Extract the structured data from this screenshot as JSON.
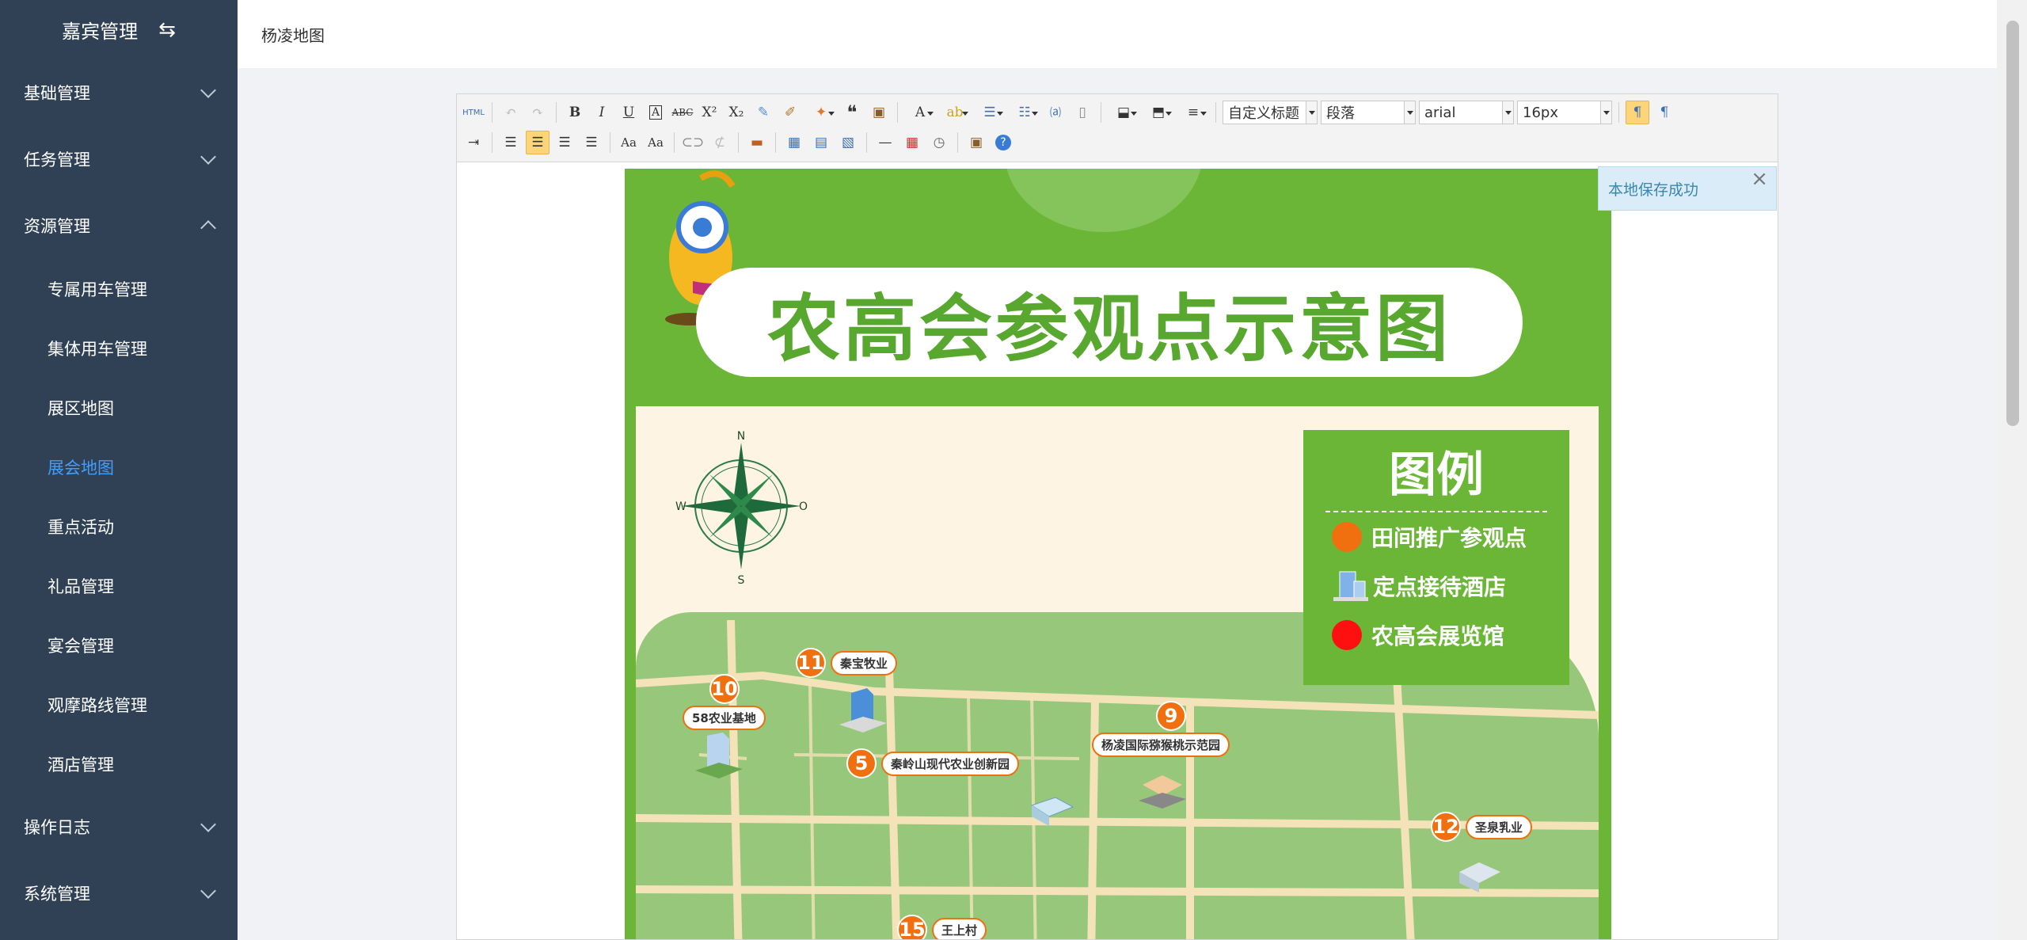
{
  "sidebar": {
    "brand": "嘉宾管理",
    "swap_icon": "⇆",
    "groups": [
      {
        "label": "基础管理",
        "expanded": false
      },
      {
        "label": "任务管理",
        "expanded": false
      },
      {
        "label": "资源管理",
        "expanded": true,
        "items": [
          "专属用车管理",
          "集体用车管理",
          "展区地图",
          "展会地图",
          "重点活动",
          "礼品管理",
          "宴会管理",
          "观摩路线管理",
          "酒店管理"
        ]
      },
      {
        "label": "操作日志",
        "expanded": false
      },
      {
        "label": "系统管理",
        "expanded": false
      }
    ],
    "active_item": "展会地图",
    "active_color": "#409eff",
    "background": "#304156"
  },
  "header": {
    "breadcrumb": "杨凌地图"
  },
  "editor": {
    "toolbar": {
      "row1_buttons": [
        "html-source",
        "undo",
        "redo",
        "bold",
        "italic",
        "underline",
        "font-border",
        "strikethrough",
        "superscript",
        "subscript",
        "remove-format",
        "format-match",
        "auto-typeset",
        "blockquote",
        "paste-plain",
        "font-color",
        "back-color",
        "insert-ordered-list",
        "insert-unordered-list",
        "select-all",
        "clear-doc",
        "row-spacing-top",
        "row-spacing-bottom",
        "line-height"
      ],
      "custom_style": "自定义标题",
      "paragraph": "段落",
      "font_family": "arial",
      "font_size": "16px",
      "row2_buttons": [
        "indent",
        "justify-left",
        "justify-center",
        "justify-right",
        "justify-justify",
        "to-uppercase",
        "to-lowercase",
        "link",
        "unlink",
        "insert-image",
        "insert-table",
        "merge-cells",
        "delete-table",
        "horizontal-rule",
        "date",
        "time",
        "paste-word",
        "help"
      ]
    },
    "html_label": "HTML",
    "toast": {
      "message": "本地保存成功",
      "close": "×"
    }
  },
  "poster": {
    "title": "农高会参观点示意图",
    "compass": {
      "n": "N",
      "s": "S",
      "w": "W",
      "e": "O"
    },
    "legend": {
      "title": "图例",
      "items": [
        {
          "icon": "orange-dot",
          "label": "田间推广参观点"
        },
        {
          "icon": "hotel-icon",
          "label": "定点接待酒店"
        },
        {
          "icon": "red-dot",
          "label": "农高会展览馆"
        }
      ]
    },
    "sites": [
      {
        "num": "11",
        "label": "秦宝牧业"
      },
      {
        "num": "10",
        "label": "58农业基地"
      },
      {
        "num": "9",
        "label": "杨凌国际猕猴桃示范园"
      },
      {
        "num": "5",
        "label": "秦岭山现代农业创新园"
      },
      {
        "num": "12",
        "label": "圣泉乳业"
      },
      {
        "num": "15",
        "label": "王上村"
      }
    ],
    "colors": {
      "green": "#6cb637",
      "orange": "#f07010",
      "red": "#ff1010",
      "cream": "#fdf4e3"
    }
  }
}
